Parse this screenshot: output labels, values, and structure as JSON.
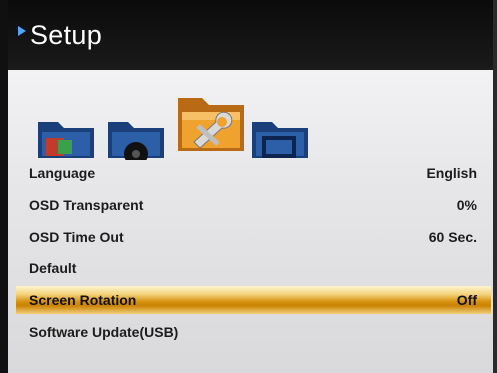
{
  "header": {
    "title": "Setup"
  },
  "icons": [
    "picture-folder-icon",
    "sound-folder-icon",
    "setup-folder-icon",
    "screen-folder-icon"
  ],
  "colors": {
    "highlight": "#d79412",
    "header_bg": "#111111",
    "accent": "#4fa3ff"
  },
  "menu": {
    "items": [
      {
        "label": "Language",
        "value": "English"
      },
      {
        "label": "OSD Transparent",
        "value": "0%"
      },
      {
        "label": "OSD Time Out",
        "value": "60 Sec."
      },
      {
        "label": "Default",
        "value": ""
      },
      {
        "label": "Screen Rotation",
        "value": "Off"
      },
      {
        "label": "Software Update(USB)",
        "value": ""
      }
    ],
    "selected_index": 4
  }
}
